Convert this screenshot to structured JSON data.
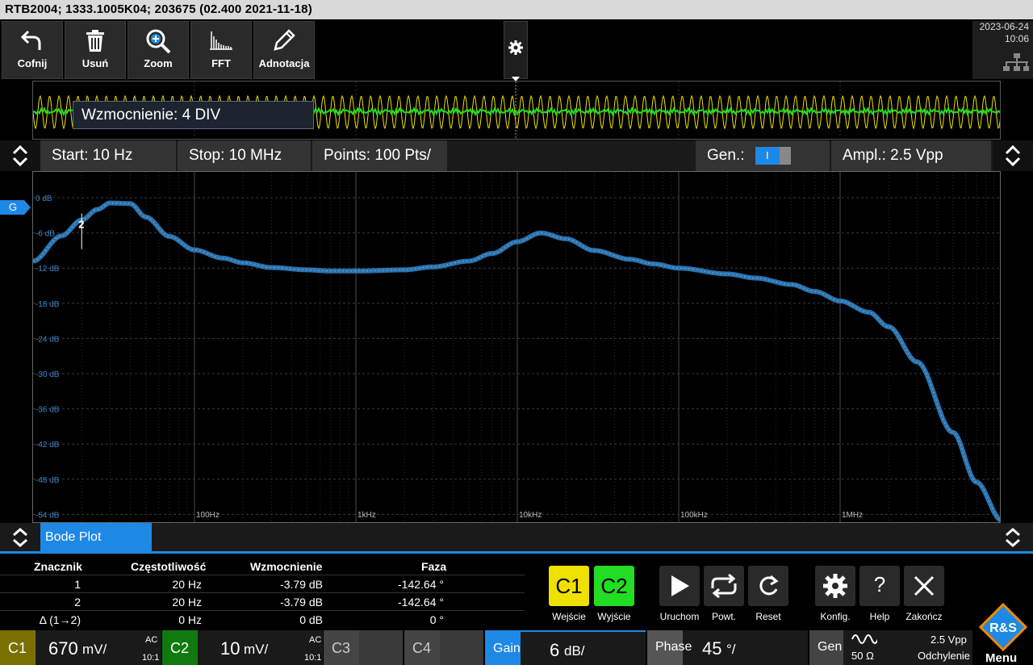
{
  "title_bar": {
    "text": "RTB2004; 1333.1005K04; 203675 (02.400 2021-11-18)"
  },
  "toolbar": {
    "undo_label": "Cofnij",
    "delete_label": "Usuń",
    "zoom_label": "Zoom",
    "fft_label": "FFT",
    "annotate_label": "Adnotacja"
  },
  "datetime": {
    "date": "2023-06-24",
    "time": "10:06"
  },
  "overview": {
    "tooltip": "Wzmocnienie: 4 DIV"
  },
  "settings": {
    "start": "Start: 10 Hz",
    "stop": "Stop: 10 MHz",
    "points": "Points: 100 Pts/",
    "gen_label": "Gen.:",
    "gen_toggle": "I",
    "ampl": "Ampl.: 2.5 Vpp"
  },
  "graph": {
    "y_ticks": [
      "0 dB",
      "-6 dB",
      "-12 dB",
      "-18 dB",
      "-24 dB",
      "-30 dB",
      "-36 dB",
      "-42 dB",
      "-48 dB",
      "-54 dB"
    ],
    "x_ticks": [
      "100Hz",
      "1kHz",
      "10kHz",
      "100kHz",
      "1MHz"
    ],
    "g_marker": "G",
    "marker_label": "2",
    "trace_color": "#2f7fc0"
  },
  "chart_data": {
    "type": "line",
    "title": "",
    "xlabel": "",
    "ylabel": "",
    "x_scale": "log",
    "xlim": [
      10,
      10000000
    ],
    "ylim": [
      -54,
      0
    ],
    "series": [
      {
        "x": [
          10,
          15,
          20,
          25,
          30,
          40,
          50,
          70,
          100,
          150,
          200,
          300,
          500,
          700,
          1000,
          2000,
          3000,
          5000,
          7000,
          10000,
          14000,
          20000,
          30000,
          50000,
          70000,
          100000,
          200000,
          300000,
          500000,
          700000,
          1000000,
          1500000,
          2000000,
          3000000,
          5000000,
          7000000,
          10000000
        ],
        "y": [
          -10.8,
          -6.5,
          -3.8,
          -2.0,
          -0.9,
          -1.0,
          -3.3,
          -6.6,
          -8.9,
          -10.3,
          -11.1,
          -11.9,
          -12.3,
          -12.5,
          -12.5,
          -12.3,
          -11.8,
          -10.8,
          -9.5,
          -7.5,
          -6.0,
          -7.0,
          -9.0,
          -10.5,
          -11.3,
          -12.0,
          -13.0,
          -13.7,
          -14.8,
          -16.0,
          -17.6,
          -19.5,
          -22.0,
          -28.0,
          -40.0,
          -48.5,
          -55.0
        ]
      }
    ],
    "markers": [
      {
        "label": "1",
        "x": 20,
        "y": -3.79
      },
      {
        "label": "2",
        "x": 20,
        "y": -3.79
      }
    ],
    "grid": true
  },
  "bottom_tab": {
    "label": "Bode Plot"
  },
  "results": {
    "headers": [
      "Znacznik",
      "Częstotliwość",
      "Wzmocnienie",
      "Faza"
    ],
    "rows": [
      [
        "1",
        "20 Hz",
        "-3.79 dB",
        "-142.64 °"
      ],
      [
        "2",
        "20 Hz",
        "-3.79 dB",
        "-142.64 °"
      ],
      [
        "Δ (1→2)",
        "0 Hz",
        "0 dB",
        "0 °"
      ]
    ]
  },
  "controls": {
    "input_label": "Wejście",
    "output_label": "Wyjście",
    "c1": "C1",
    "c2": "C2",
    "run_label": "Uruchom",
    "repeat_label": "Powt.",
    "reset_label": "Reset",
    "config_label": "Konfig.",
    "help_label": "Help",
    "help_glyph": "?",
    "exit_label": "Zakończ"
  },
  "channels": {
    "c1": {
      "tag": "C1",
      "value": "670",
      "unit": "mV/",
      "coupling": "AC",
      "probe": "10:1"
    },
    "c2": {
      "tag": "C2",
      "value": "10",
      "unit": "mV/",
      "coupling": "AC",
      "probe": "10:1"
    },
    "c3": {
      "tag": "C3"
    },
    "c4": {
      "tag": "C4"
    },
    "gain": {
      "tag": "Gain",
      "value": "6",
      "unit": "dB/"
    },
    "phase": {
      "tag": "Phase",
      "value": "45",
      "unit": "°/"
    },
    "gen": {
      "tag": "Gen",
      "impedance": "50 Ω",
      "ampl": "2.5 Vpp",
      "mode": "Odchylenie"
    },
    "menu_label": "Menu",
    "logo_text": "R&S"
  },
  "colors": {
    "c1": "#f0e000",
    "c2": "#22dd22",
    "accent": "#1e88e5"
  }
}
